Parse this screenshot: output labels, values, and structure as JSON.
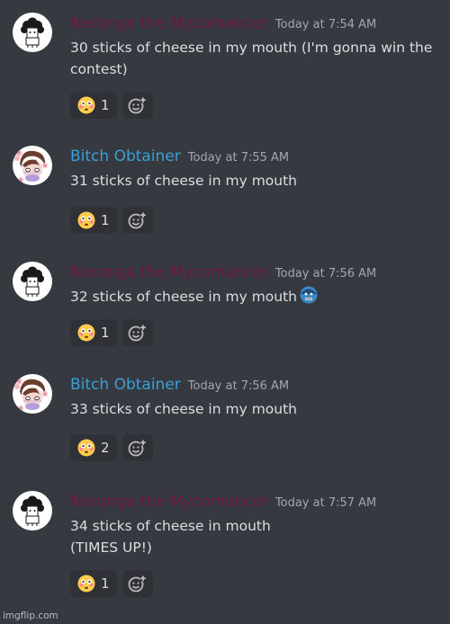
{
  "messages": [
    {
      "author": "Neronga the Mycomancer",
      "author_color": "#6b1a3a",
      "timestamp": "Today at 7:54 AM",
      "line1": "30 sticks of cheese in my mouth (I'm gonna win the",
      "line2": "contest)",
      "reaction_count": "1",
      "reaction_emoji": "flushed-face-emoji"
    },
    {
      "author": "Bitch Obtainer",
      "author_color": "#3aa0d8",
      "timestamp": "Today at 7:55 AM",
      "line1": "31 sticks of cheese in my mouth",
      "reaction_count": "1",
      "reaction_emoji": "flushed-face-emoji"
    },
    {
      "author": "Neronga the Mycomancer",
      "author_color": "#6b1a3a",
      "timestamp": "Today at 7:56 AM",
      "line1": "32 sticks of cheese in my mouth",
      "inline_emoji": "cold-sweat-face-emoji",
      "reaction_count": "1",
      "reaction_emoji": "flushed-face-emoji"
    },
    {
      "author": "Bitch Obtainer",
      "author_color": "#3aa0d8",
      "timestamp": "Today at 7:56 AM",
      "line1": "33 sticks of cheese in my mouth",
      "reaction_count": "2",
      "reaction_emoji": "flushed-face-emoji"
    },
    {
      "author": "Neronga the Mycomancer",
      "author_color": "#6b1a3a",
      "timestamp": "Today at 7:57 AM",
      "line1": "34 sticks of cheese in mouth",
      "line2": "(TIMES UP!)",
      "reaction_count": "1",
      "reaction_emoji": "flushed-face-emoji"
    }
  ],
  "add_reaction_icon": "add-reaction-icon",
  "watermark": "imgflip.com",
  "colors": {
    "background": "#36393f",
    "reaction_bg": "#2f3136",
    "text": "#dcddde",
    "timestamp": "#a3a6aa"
  }
}
